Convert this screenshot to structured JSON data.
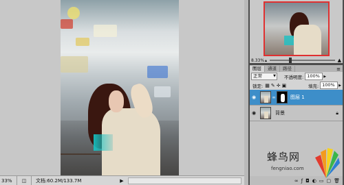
{
  "status_bar": {
    "zoom": "33%",
    "doc_info": "文档:60.2M/133.7M",
    "arrow": "▶"
  },
  "navigator": {
    "zoom": "8.33%"
  },
  "layers_panel": {
    "tabs": [
      {
        "label": "图层"
      },
      {
        "label": "通道"
      },
      {
        "label": "路径"
      }
    ],
    "blend_mode": "正常",
    "opacity_label": "不透明度:",
    "opacity_value": "100%",
    "lock_label": "锁定:",
    "fill_label": "填充:",
    "fill_value": "100%",
    "layers": [
      {
        "name": "图层 1",
        "selected": true
      },
      {
        "name": "背景",
        "selected": false
      }
    ]
  },
  "watermark": {
    "brand": "蜂鸟网",
    "url": "fengniao.com"
  },
  "colors": {
    "selection": "#3d8ec9",
    "panel_bg": "#d4d4d4",
    "workspace": "#c8c8c8"
  }
}
